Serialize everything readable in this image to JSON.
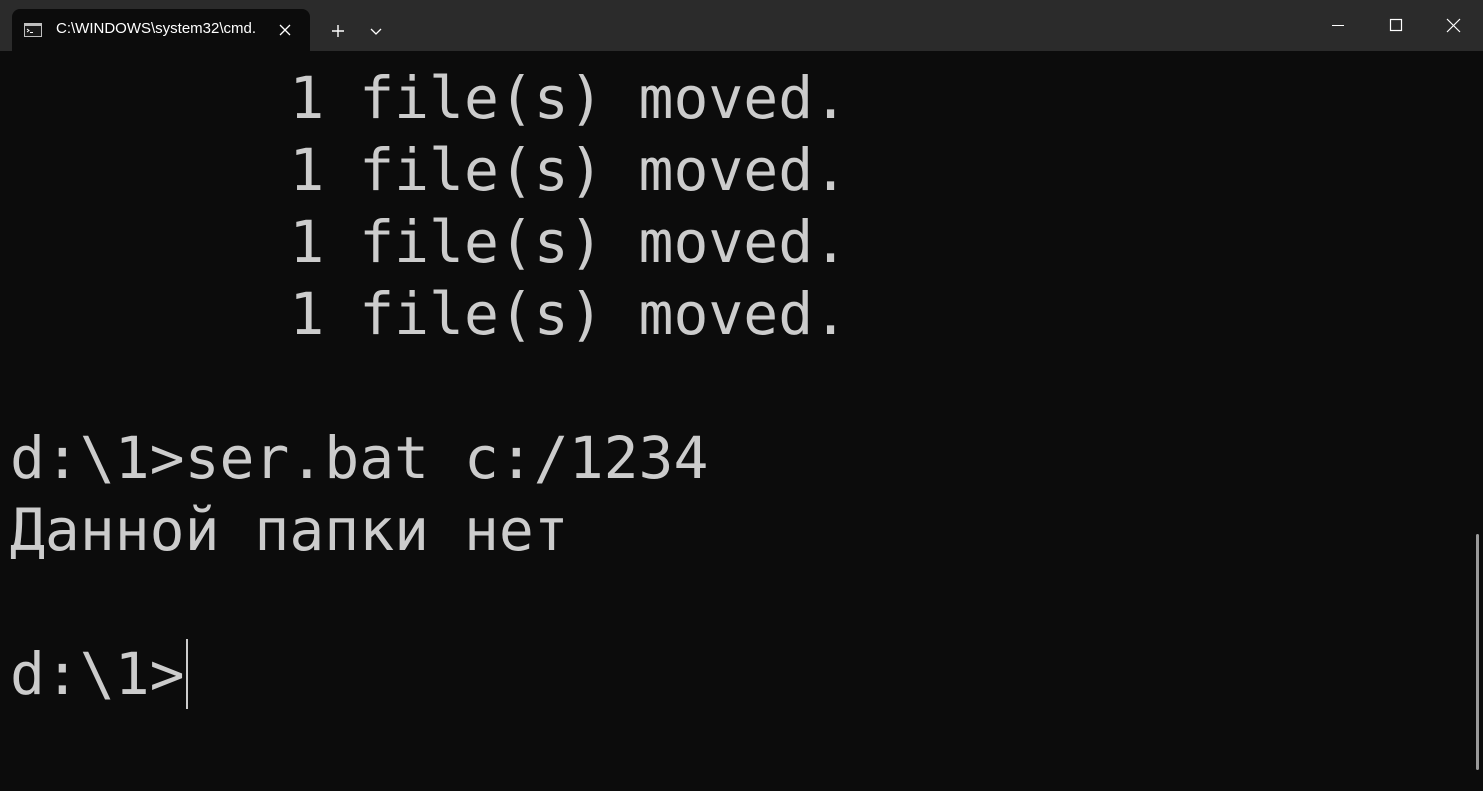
{
  "tab": {
    "title": "C:\\WINDOWS\\system32\\cmd.",
    "icon": "cmd-icon"
  },
  "titlebar": {
    "new_tab_icon": "plus-icon",
    "dropdown_icon": "chevron-down-icon",
    "minimize_icon": "minimize-icon",
    "maximize_icon": "maximize-icon",
    "close_icon": "close-icon"
  },
  "terminal": {
    "lines": [
      "        1 file(s) moved.",
      "        1 file(s) moved.",
      "        1 file(s) moved.",
      "        1 file(s) moved.",
      "d:\\1>ser.bat c:/1234",
      "Данной папки нет",
      "d:\\1>"
    ],
    "foreground": "#cccccc",
    "background": "#0c0c0c"
  }
}
